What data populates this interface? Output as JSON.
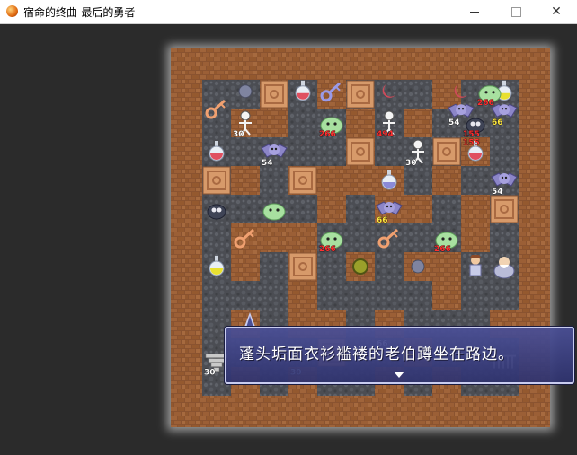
{
  "window": {
    "title": "宿命的终曲-最后的勇者",
    "minimize_symbol": "—",
    "close_symbol": "✕"
  },
  "dialog": {
    "text": "蓬头垢面衣衫褴褛的老伯蹲坐在路边。"
  },
  "monster_labels": [
    "30",
    "54",
    "66",
    "155",
    "266",
    "494",
    "30",
    "54",
    "155",
    "266",
    "266",
    "266",
    "66",
    "54",
    "30",
    "30",
    "66"
  ],
  "colors": {
    "brick": "#8a5330",
    "floor": "#4d4f55",
    "hp_white": "#ffffff",
    "hp_red": "#ff3030",
    "hp_yellow": "#ffe840"
  },
  "icons": {
    "app": "orange-orb-icon",
    "dialog_continue": "down-triangle-icon"
  }
}
